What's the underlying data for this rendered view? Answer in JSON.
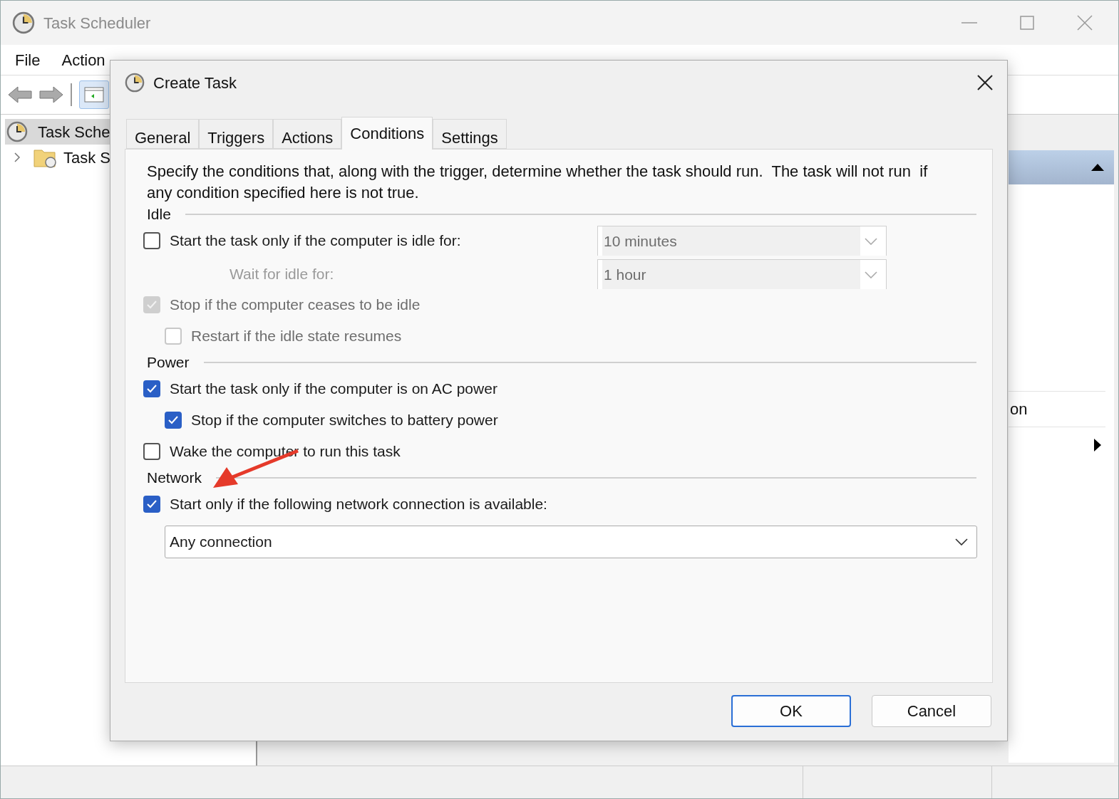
{
  "main_window": {
    "title": "Task Scheduler",
    "menu": [
      "File",
      "Action"
    ],
    "tree": [
      {
        "label": "Task Sche",
        "selected": true,
        "children": [
          {
            "label": "Task S",
            "selected": false
          }
        ]
      }
    ],
    "actions_pane": {
      "items": [
        {
          "label": "on",
          "kind": "text"
        },
        {
          "kind": "submenu"
        }
      ]
    }
  },
  "dialog": {
    "title": "Create Task",
    "tabs": [
      {
        "label": "General",
        "selected": false
      },
      {
        "label": "Triggers",
        "selected": false
      },
      {
        "label": "Actions",
        "selected": false
      },
      {
        "label": "Conditions",
        "selected": true
      },
      {
        "label": "Settings",
        "selected": false
      }
    ],
    "description": "Specify the conditions that, along with the trigger, determine whether the task should run.  The task will not run  if any condition specified here is not true.",
    "sections": [
      {
        "heading": "Idle",
        "items": [
          {
            "kind": "checkbox",
            "label": "Start the task only if the computer is idle for:",
            "checked": false,
            "disabled": false,
            "dropdown": {
              "value": "10 minutes",
              "disabled": true
            }
          },
          {
            "kind": "field",
            "label": "Wait for idle for:",
            "disabled": true,
            "dropdown": {
              "value": "1 hour",
              "disabled": true
            }
          },
          {
            "kind": "checkbox",
            "label": "Stop if the computer ceases to be idle",
            "checked": true,
            "disabled": true,
            "children": [
              {
                "kind": "checkbox",
                "label": "Restart if the idle state resumes",
                "checked": false,
                "disabled": true
              }
            ]
          }
        ]
      },
      {
        "heading": "Power",
        "items": [
          {
            "kind": "checkbox",
            "label": "Start the task only if the computer is on AC power",
            "checked": true,
            "disabled": false,
            "children": [
              {
                "kind": "checkbox",
                "label": "Stop if the computer switches to battery power",
                "checked": true,
                "disabled": false
              }
            ]
          },
          {
            "kind": "checkbox",
            "label": "Wake the computer to run this task",
            "checked": false,
            "disabled": false
          }
        ]
      },
      {
        "heading": "Network",
        "items": [
          {
            "kind": "checkbox",
            "label": "Start only if the following network connection is available:",
            "checked": true,
            "disabled": false
          },
          {
            "kind": "dropdown",
            "value": "Any connection",
            "disabled": false
          }
        ]
      }
    ],
    "buttons": [
      {
        "label": "OK",
        "selected": true
      },
      {
        "label": "Cancel",
        "selected": false
      }
    ]
  }
}
